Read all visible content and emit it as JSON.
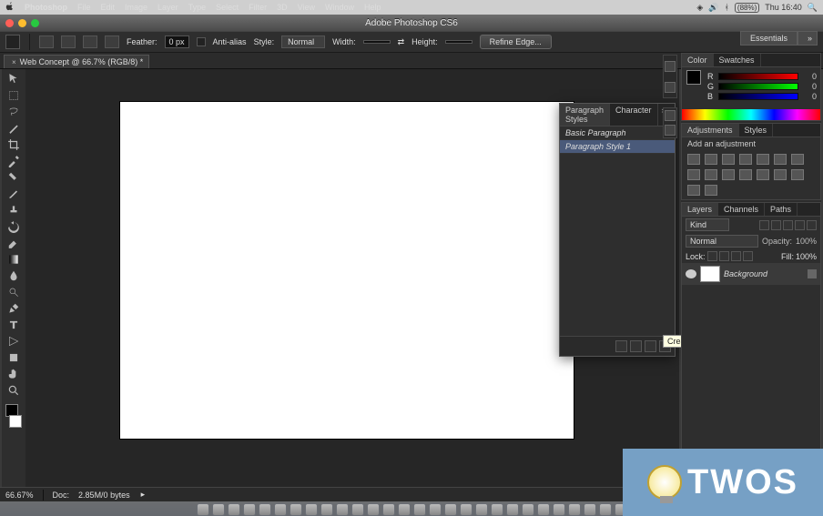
{
  "mac": {
    "appname": "Photoshop",
    "menus": [
      "File",
      "Edit",
      "Image",
      "Layer",
      "Type",
      "Select",
      "Filter",
      "3D",
      "View",
      "Window",
      "Help"
    ],
    "battery": "(88%)",
    "clock": "Thu 16:40"
  },
  "window": {
    "title": "Adobe Photoshop CS6"
  },
  "options": {
    "feather_label": "Feather:",
    "feather_value": "0 px",
    "antialias_label": "Anti-alias",
    "antialias_checked": false,
    "style_label": "Style:",
    "style_value": "Normal",
    "width_label": "Width:",
    "width_value": "",
    "height_label": "Height:",
    "height_value": "",
    "refine": "Refine Edge...",
    "workspace": "Essentials"
  },
  "doc_tab": {
    "title": "Web Concept @ 66.7% (RGB/8) *"
  },
  "status": {
    "zoom": "66.67%",
    "info_label": "Doc:",
    "info_value": "2.85M/0 bytes"
  },
  "color_panel": {
    "tabs": [
      "Color",
      "Swatches"
    ],
    "active": 0,
    "rgb": {
      "r": 0,
      "g": 0,
      "b": 0
    }
  },
  "adjustments_panel": {
    "tabs": [
      "Adjustments",
      "Styles"
    ],
    "active": 0,
    "hint": "Add an adjustment"
  },
  "layers_panel": {
    "tabs": [
      "Layers",
      "Channels",
      "Paths"
    ],
    "active": 0,
    "kind_label": "Kind",
    "blend_mode": "Normal",
    "opacity_label": "Opacity:",
    "opacity_value": "100%",
    "lock_label": "Lock:",
    "fill_label": "Fill:",
    "fill_value": "100%",
    "layers": [
      {
        "name": "Background",
        "locked": true,
        "visible": true
      }
    ]
  },
  "paragraph_panel": {
    "tabs": [
      "Paragraph Styles",
      "Character"
    ],
    "active": 0,
    "items": [
      "Basic Paragraph",
      "Paragraph Style 1"
    ],
    "selected": 1,
    "tooltip": "Create new Paragraph Style",
    "footer_icons": [
      "undo-icon",
      "accept-icon",
      "new-style-icon",
      "trash-icon"
    ]
  },
  "tools": [
    "move",
    "marquee",
    "lasso",
    "wand",
    "crop",
    "eyedrop",
    "heal",
    "brush",
    "stamp",
    "history",
    "eraser",
    "gradient",
    "blur",
    "dodge",
    "pen",
    "type",
    "path",
    "shape",
    "hand",
    "zoom"
  ],
  "dock_count": 28,
  "watermark": "TWOS"
}
